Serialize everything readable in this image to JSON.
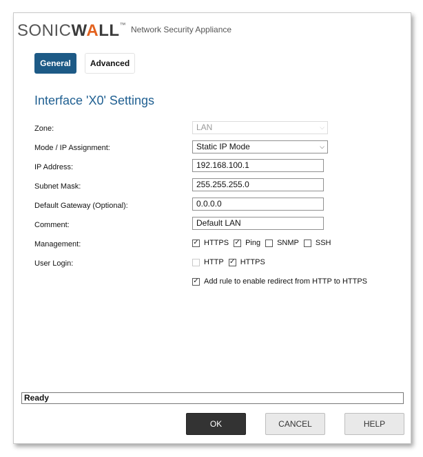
{
  "header": {
    "logo_part1": "SONIC",
    "logo_part2": "W",
    "logo_accent": "A",
    "logo_part3": "LL",
    "logo_tm": "™",
    "product": "Network Security Appliance"
  },
  "tabs": [
    {
      "label": "General",
      "active": true
    },
    {
      "label": "Advanced",
      "active": false
    }
  ],
  "section_title": "Interface 'X0' Settings",
  "form": {
    "zone": {
      "label": "Zone:",
      "value": "LAN",
      "disabled": true
    },
    "mode": {
      "label": "Mode / IP Assignment:",
      "value": "Static IP Mode"
    },
    "ip_address": {
      "label": "IP Address:",
      "value": "192.168.100.1"
    },
    "subnet_mask": {
      "label": "Subnet Mask:",
      "value": "255.255.255.0"
    },
    "gateway": {
      "label": "Default Gateway (Optional):",
      "value": "0.0.0.0"
    },
    "comment": {
      "label": "Comment:",
      "value": "Default LAN"
    },
    "management": {
      "label": "Management:",
      "options": [
        {
          "label": "HTTPS",
          "checked": true
        },
        {
          "label": "Ping",
          "checked": true
        },
        {
          "label": "SNMP",
          "checked": false
        },
        {
          "label": "SSH",
          "checked": false
        }
      ]
    },
    "user_login": {
      "label": "User Login:",
      "options": [
        {
          "label": "HTTP",
          "checked": false,
          "disabled": true
        },
        {
          "label": "HTTPS",
          "checked": true
        }
      ]
    },
    "redirect": {
      "label": "Add rule to enable redirect from HTTP to HTTPS",
      "checked": true
    }
  },
  "status_text": "Ready",
  "buttons": {
    "ok": "OK",
    "cancel": "CANCEL",
    "help": "HELP"
  },
  "colors": {
    "accent": "#1d5a86",
    "title": "#1f5f91",
    "brand_orange": "#e3621e"
  },
  "check_glyph": "✓"
}
